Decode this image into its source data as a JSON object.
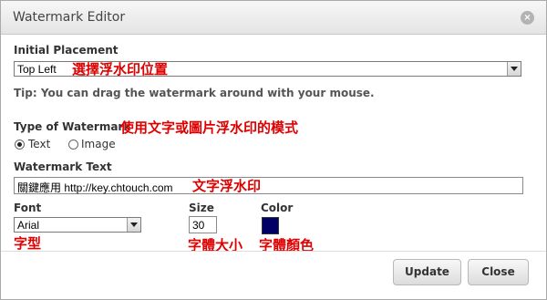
{
  "dialog": {
    "title": "Watermark Editor",
    "close_glyph": "×"
  },
  "placement": {
    "label": "Initial Placement",
    "selected": "Top Left",
    "annotation": "選擇浮水印位置",
    "tip": "Tip: You can drag the watermark around with your mouse."
  },
  "type": {
    "label": "Type of Watermark",
    "annotation": "使用文字或圖片浮水印的模式",
    "options": [
      {
        "label": "Text",
        "selected": true
      },
      {
        "label": "Image",
        "selected": false
      }
    ]
  },
  "text": {
    "label": "Watermark Text",
    "value": "關鍵應用 http://key.chtouch.com",
    "annotation": "文字浮水印"
  },
  "font": {
    "label": "Font",
    "selected": "Arial",
    "annotation": "字型"
  },
  "size": {
    "label": "Size",
    "value": "30",
    "annotation": "字體大小"
  },
  "color": {
    "label": "Color",
    "value": "#000066",
    "annotation": "字體顏色"
  },
  "buttons": {
    "update": "Update",
    "close": "Close"
  }
}
